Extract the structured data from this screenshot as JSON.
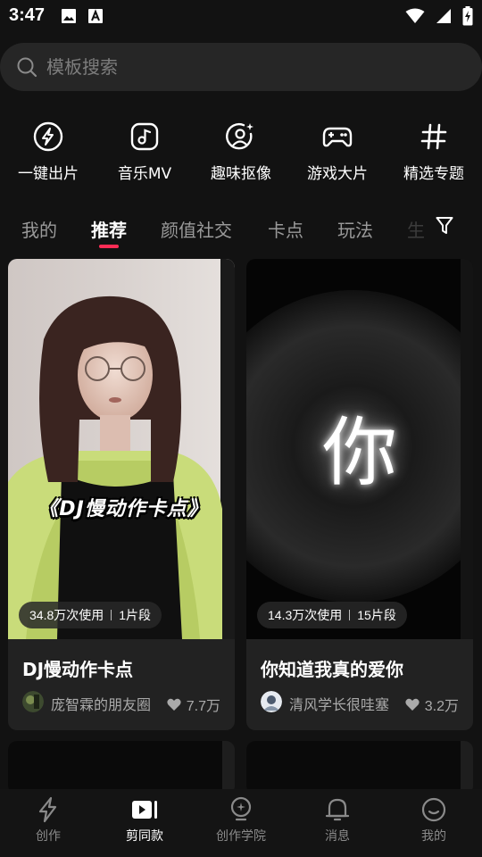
{
  "status_bar": {
    "time": "3:47"
  },
  "search": {
    "placeholder": "模板搜索"
  },
  "shortcuts": [
    {
      "label": "一键出片",
      "icon": "lightning-circle-icon"
    },
    {
      "label": "音乐MV",
      "icon": "music-note-icon"
    },
    {
      "label": "趣味抠像",
      "icon": "portrait-sparkle-icon"
    },
    {
      "label": "游戏大片",
      "icon": "gamepad-icon"
    },
    {
      "label": "精选专题",
      "icon": "hashtag-icon"
    }
  ],
  "tabs": [
    {
      "label": "我的",
      "active": false
    },
    {
      "label": "推荐",
      "active": true
    },
    {
      "label": "颜值社交",
      "active": false
    },
    {
      "label": "卡点",
      "active": false
    },
    {
      "label": "玩法",
      "active": false
    },
    {
      "label": "生",
      "active": false
    }
  ],
  "cards": [
    {
      "overlay_text": "《DJ慢动作卡点》",
      "uses": "34.8万次使用",
      "segments": "1片段",
      "title": "DJ慢动作卡点",
      "author": "庞智霖的朋友圈",
      "likes": "7.7万"
    },
    {
      "overlay_text": "你",
      "uses": "14.3万次使用",
      "segments": "15片段",
      "title": "你知道我真的爱你",
      "author": "清风学长很哇塞",
      "likes": "3.2万"
    }
  ],
  "bottom_nav": [
    {
      "label": "创作",
      "icon": "lightning-icon",
      "active": false
    },
    {
      "label": "剪同款",
      "icon": "video-template-icon",
      "active": true
    },
    {
      "label": "创作学院",
      "icon": "lightbulb-icon",
      "active": false
    },
    {
      "label": "消息",
      "icon": "bell-icon",
      "active": false
    },
    {
      "label": "我的",
      "icon": "smiley-icon",
      "active": false
    }
  ],
  "colors": {
    "background": "#121212",
    "accent": "#fe2c55",
    "card": "#222222"
  }
}
